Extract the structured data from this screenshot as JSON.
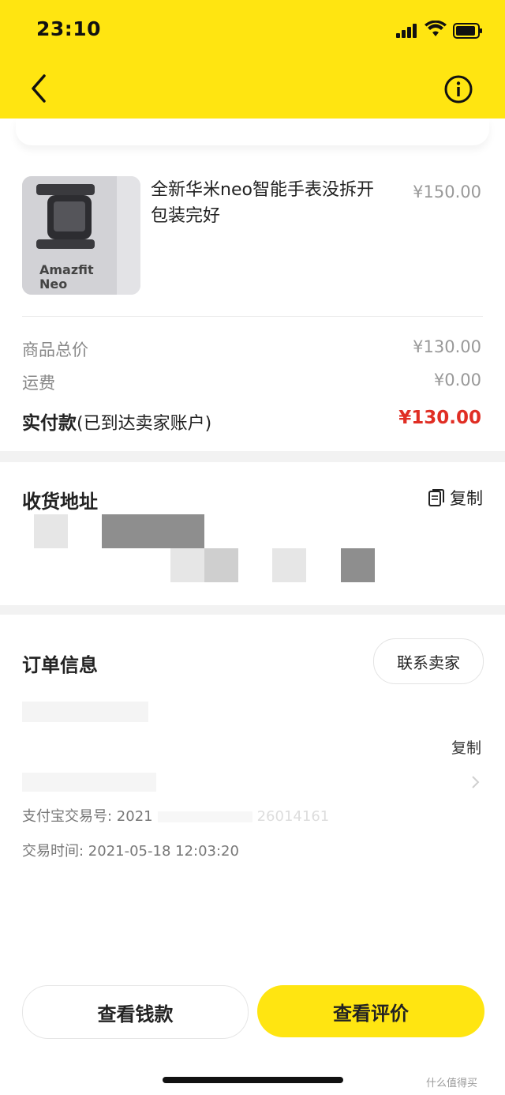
{
  "status_bar": {
    "time": "23:10"
  },
  "product": {
    "title": "全新华米neo智能手表没拆开包装完好",
    "price": "¥150.00",
    "image_caption_line1": "Amazfit",
    "image_caption_line2": "Neo"
  },
  "pricing": {
    "rows": [
      {
        "label": "商品总价",
        "value": "¥130.00"
      },
      {
        "label": "运费",
        "value": "¥0.00"
      }
    ],
    "paid_label": "实付款",
    "paid_note": "(已到达卖家账户)",
    "paid_value": "¥130.00"
  },
  "address": {
    "title": "收货地址",
    "copy_label": "复制"
  },
  "order_info": {
    "title": "订单信息",
    "contact_label": "联系卖家",
    "copy_label": "复制",
    "alipay_label": "支付宝交易号: 2021",
    "alipay_tail": "26014161",
    "time_label": "交易时间: 2021-05-18 12:03:20"
  },
  "footer": {
    "view_money_label": "查看钱款",
    "view_review_label": "查看评价"
  },
  "watermark": "什么值得买",
  "colors": {
    "accent": "#FFE511",
    "price_red": "#e02e24"
  }
}
